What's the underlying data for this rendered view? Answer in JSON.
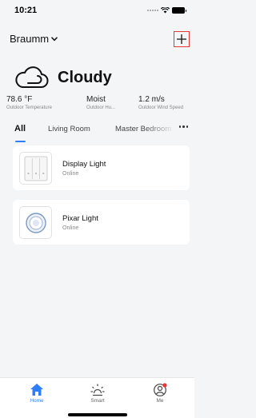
{
  "status_bar": {
    "time": "10:21"
  },
  "header": {
    "home_name": "Braumm"
  },
  "weather": {
    "condition": "Cloudy",
    "stats": [
      {
        "value": "78.6 °F",
        "label": "Outdoor Temperature"
      },
      {
        "value": "Moist",
        "label": "Outdoor Hu..."
      },
      {
        "value": "1.2 m/s",
        "label": "Outdoor Wind Speed"
      }
    ]
  },
  "tabs": [
    {
      "label": "All",
      "active": true
    },
    {
      "label": "Living Room",
      "active": false
    },
    {
      "label": "Master Bedroom",
      "active": false
    }
  ],
  "devices": [
    {
      "name": "Display Light",
      "status": "Online",
      "icon": "wall-switch-icon"
    },
    {
      "name": "Pixar Light",
      "status": "Online",
      "icon": "round-light-icon"
    }
  ],
  "bottom_nav": [
    {
      "label": "Home",
      "icon": "home-icon",
      "active": true
    },
    {
      "label": "Smart",
      "icon": "sun-icon",
      "active": false
    },
    {
      "label": "Me",
      "icon": "user-icon",
      "active": false,
      "badge": true
    }
  ],
  "colors": {
    "accent": "#2d7ff9",
    "badge": "#e53935",
    "background": "#f4f5f7"
  }
}
